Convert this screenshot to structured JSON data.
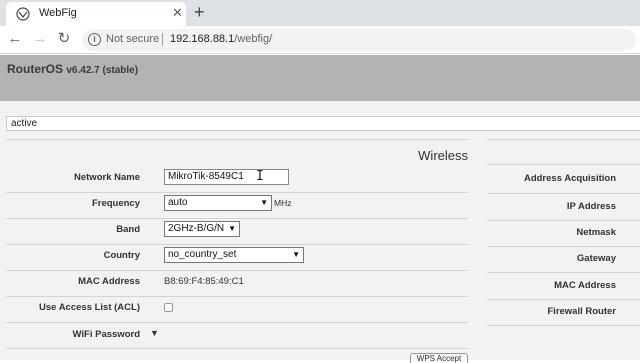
{
  "browser": {
    "tab_title": "WebFig",
    "close_glyph": "✕",
    "new_tab_glyph": "+",
    "back_glyph": "←",
    "forward_glyph": "→",
    "reload_glyph": "↻",
    "info_glyph": "i",
    "security_text": "Not secure",
    "url_host": "192.168.88.1",
    "url_path": "/webfig/"
  },
  "header": {
    "brand": "RouterOS",
    "version": "v6.42.7 (stable)"
  },
  "status": {
    "value": "active"
  },
  "wireless": {
    "section_title": "Wireless",
    "network_name": {
      "label": "Network Name",
      "value": "MikroTik-8549C1"
    },
    "frequency": {
      "label": "Frequency",
      "value": "auto",
      "unit": "MHz"
    },
    "band": {
      "label": "Band",
      "value": "2GHz-B/G/N"
    },
    "country": {
      "label": "Country",
      "value": "no_country_set"
    },
    "mac_address": {
      "label": "MAC Address",
      "value": "B8:69:F4:85:49:C1"
    },
    "access_list": {
      "label": "Use Access List (ACL)",
      "checked": false
    },
    "wifi_password": {
      "label": "WiFi Password"
    },
    "bottom_button": "WPS Accept"
  },
  "internet": {
    "labels": [
      "Address Acquisition",
      "IP Address",
      "Netmask",
      "Gateway",
      "MAC Address",
      "Firewall Router"
    ]
  },
  "icons": {
    "dropdown": "▼",
    "toggle": "▼",
    "text_cursor": "I"
  }
}
